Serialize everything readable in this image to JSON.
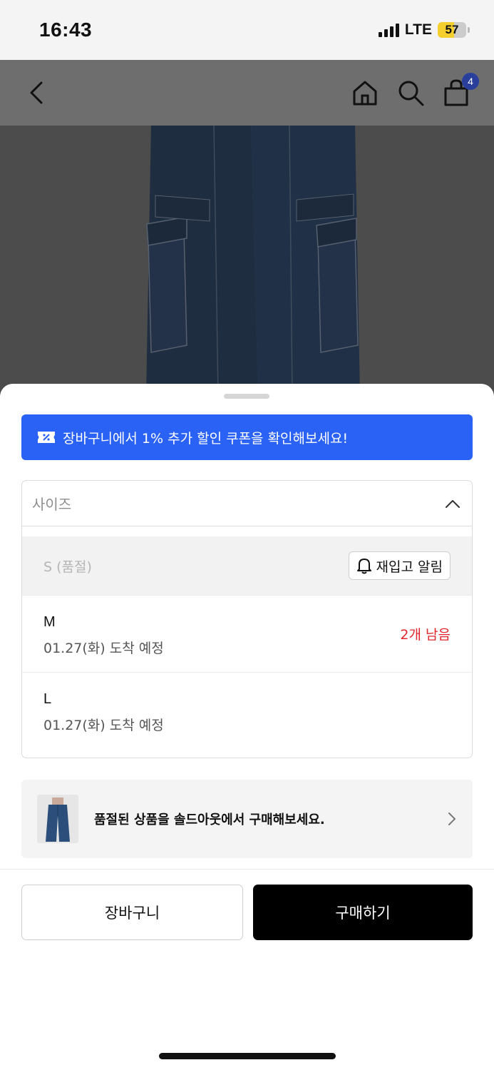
{
  "status_bar": {
    "time": "16:43",
    "network": "LTE",
    "battery_level": "57",
    "battery_color": "#f5cf2e"
  },
  "nav": {
    "back_icon": "chevron-left-icon",
    "home_icon": "home-icon",
    "search_icon": "search-icon",
    "cart_icon": "shopping-bag-icon",
    "cart_count": "4"
  },
  "sheet": {
    "coupon_banner": {
      "icon": "coupon-icon",
      "text": "장바구니에서 1% 추가 할인 쿠폰을 확인해보세요!",
      "background": "#2a62f5"
    },
    "size_select": {
      "placeholder": "사이즈",
      "icon": "chevron-up-icon",
      "options": [
        {
          "label": "S (품절)",
          "restock_button": "재입고 알림"
        },
        {
          "size": "M",
          "delivery": "01.27(화) 도착 예정",
          "stock": "2개 남음"
        },
        {
          "size": "L",
          "delivery": "01.27(화) 도착 예정"
        }
      ]
    },
    "soldout_banner": {
      "text": "품절된 상품을 솔드아웃에서 구매해보세요.",
      "icon": "chevron-right-icon"
    },
    "actions": {
      "cart_label": "장바구니",
      "buy_label": "구매하기"
    }
  }
}
